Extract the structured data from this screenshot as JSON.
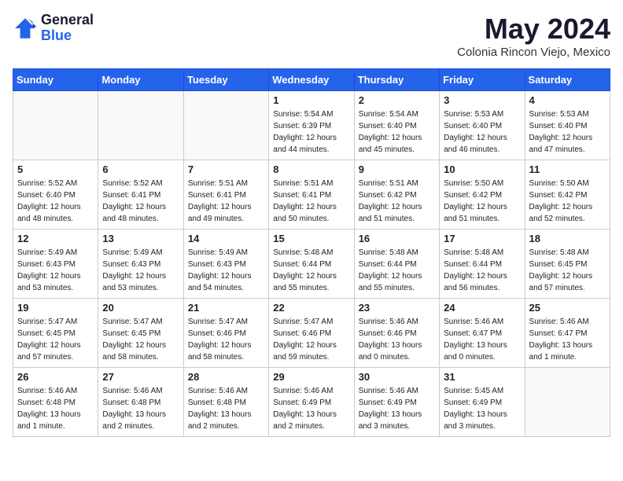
{
  "header": {
    "logo_general": "General",
    "logo_blue": "Blue",
    "month": "May 2024",
    "location": "Colonia Rincon Viejo, Mexico"
  },
  "days_of_week": [
    "Sunday",
    "Monday",
    "Tuesday",
    "Wednesday",
    "Thursday",
    "Friday",
    "Saturday"
  ],
  "weeks": [
    [
      {
        "day": "",
        "info": ""
      },
      {
        "day": "",
        "info": ""
      },
      {
        "day": "",
        "info": ""
      },
      {
        "day": "1",
        "info": "Sunrise: 5:54 AM\nSunset: 6:39 PM\nDaylight: 12 hours\nand 44 minutes."
      },
      {
        "day": "2",
        "info": "Sunrise: 5:54 AM\nSunset: 6:40 PM\nDaylight: 12 hours\nand 45 minutes."
      },
      {
        "day": "3",
        "info": "Sunrise: 5:53 AM\nSunset: 6:40 PM\nDaylight: 12 hours\nand 46 minutes."
      },
      {
        "day": "4",
        "info": "Sunrise: 5:53 AM\nSunset: 6:40 PM\nDaylight: 12 hours\nand 47 minutes."
      }
    ],
    [
      {
        "day": "5",
        "info": "Sunrise: 5:52 AM\nSunset: 6:40 PM\nDaylight: 12 hours\nand 48 minutes."
      },
      {
        "day": "6",
        "info": "Sunrise: 5:52 AM\nSunset: 6:41 PM\nDaylight: 12 hours\nand 48 minutes."
      },
      {
        "day": "7",
        "info": "Sunrise: 5:51 AM\nSunset: 6:41 PM\nDaylight: 12 hours\nand 49 minutes."
      },
      {
        "day": "8",
        "info": "Sunrise: 5:51 AM\nSunset: 6:41 PM\nDaylight: 12 hours\nand 50 minutes."
      },
      {
        "day": "9",
        "info": "Sunrise: 5:51 AM\nSunset: 6:42 PM\nDaylight: 12 hours\nand 51 minutes."
      },
      {
        "day": "10",
        "info": "Sunrise: 5:50 AM\nSunset: 6:42 PM\nDaylight: 12 hours\nand 51 minutes."
      },
      {
        "day": "11",
        "info": "Sunrise: 5:50 AM\nSunset: 6:42 PM\nDaylight: 12 hours\nand 52 minutes."
      }
    ],
    [
      {
        "day": "12",
        "info": "Sunrise: 5:49 AM\nSunset: 6:43 PM\nDaylight: 12 hours\nand 53 minutes."
      },
      {
        "day": "13",
        "info": "Sunrise: 5:49 AM\nSunset: 6:43 PM\nDaylight: 12 hours\nand 53 minutes."
      },
      {
        "day": "14",
        "info": "Sunrise: 5:49 AM\nSunset: 6:43 PM\nDaylight: 12 hours\nand 54 minutes."
      },
      {
        "day": "15",
        "info": "Sunrise: 5:48 AM\nSunset: 6:44 PM\nDaylight: 12 hours\nand 55 minutes."
      },
      {
        "day": "16",
        "info": "Sunrise: 5:48 AM\nSunset: 6:44 PM\nDaylight: 12 hours\nand 55 minutes."
      },
      {
        "day": "17",
        "info": "Sunrise: 5:48 AM\nSunset: 6:44 PM\nDaylight: 12 hours\nand 56 minutes."
      },
      {
        "day": "18",
        "info": "Sunrise: 5:48 AM\nSunset: 6:45 PM\nDaylight: 12 hours\nand 57 minutes."
      }
    ],
    [
      {
        "day": "19",
        "info": "Sunrise: 5:47 AM\nSunset: 6:45 PM\nDaylight: 12 hours\nand 57 minutes."
      },
      {
        "day": "20",
        "info": "Sunrise: 5:47 AM\nSunset: 6:45 PM\nDaylight: 12 hours\nand 58 minutes."
      },
      {
        "day": "21",
        "info": "Sunrise: 5:47 AM\nSunset: 6:46 PM\nDaylight: 12 hours\nand 58 minutes."
      },
      {
        "day": "22",
        "info": "Sunrise: 5:47 AM\nSunset: 6:46 PM\nDaylight: 12 hours\nand 59 minutes."
      },
      {
        "day": "23",
        "info": "Sunrise: 5:46 AM\nSunset: 6:46 PM\nDaylight: 13 hours\nand 0 minutes."
      },
      {
        "day": "24",
        "info": "Sunrise: 5:46 AM\nSunset: 6:47 PM\nDaylight: 13 hours\nand 0 minutes."
      },
      {
        "day": "25",
        "info": "Sunrise: 5:46 AM\nSunset: 6:47 PM\nDaylight: 13 hours\nand 1 minute."
      }
    ],
    [
      {
        "day": "26",
        "info": "Sunrise: 5:46 AM\nSunset: 6:48 PM\nDaylight: 13 hours\nand 1 minute."
      },
      {
        "day": "27",
        "info": "Sunrise: 5:46 AM\nSunset: 6:48 PM\nDaylight: 13 hours\nand 2 minutes."
      },
      {
        "day": "28",
        "info": "Sunrise: 5:46 AM\nSunset: 6:48 PM\nDaylight: 13 hours\nand 2 minutes."
      },
      {
        "day": "29",
        "info": "Sunrise: 5:46 AM\nSunset: 6:49 PM\nDaylight: 13 hours\nand 2 minutes."
      },
      {
        "day": "30",
        "info": "Sunrise: 5:46 AM\nSunset: 6:49 PM\nDaylight: 13 hours\nand 3 minutes."
      },
      {
        "day": "31",
        "info": "Sunrise: 5:45 AM\nSunset: 6:49 PM\nDaylight: 13 hours\nand 3 minutes."
      },
      {
        "day": "",
        "info": ""
      }
    ]
  ]
}
